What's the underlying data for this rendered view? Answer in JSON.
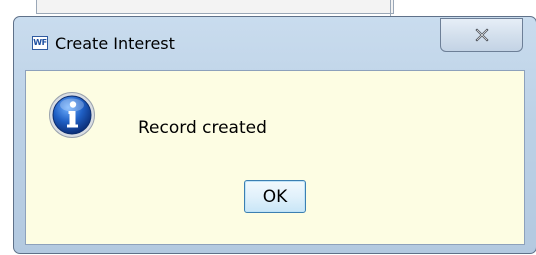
{
  "dialog": {
    "title": "Create Interest",
    "app_icon_text": "WF",
    "close_icon": "close-x-icon",
    "message_icon": "info-icon",
    "message": "Record created",
    "ok_label": "OK"
  },
  "colors": {
    "titlebar": "#bcd1e6",
    "client_background": "#fdfde3",
    "ok_button_border": "#3c7fb1",
    "info_icon_blue": "#1f5fc4"
  }
}
